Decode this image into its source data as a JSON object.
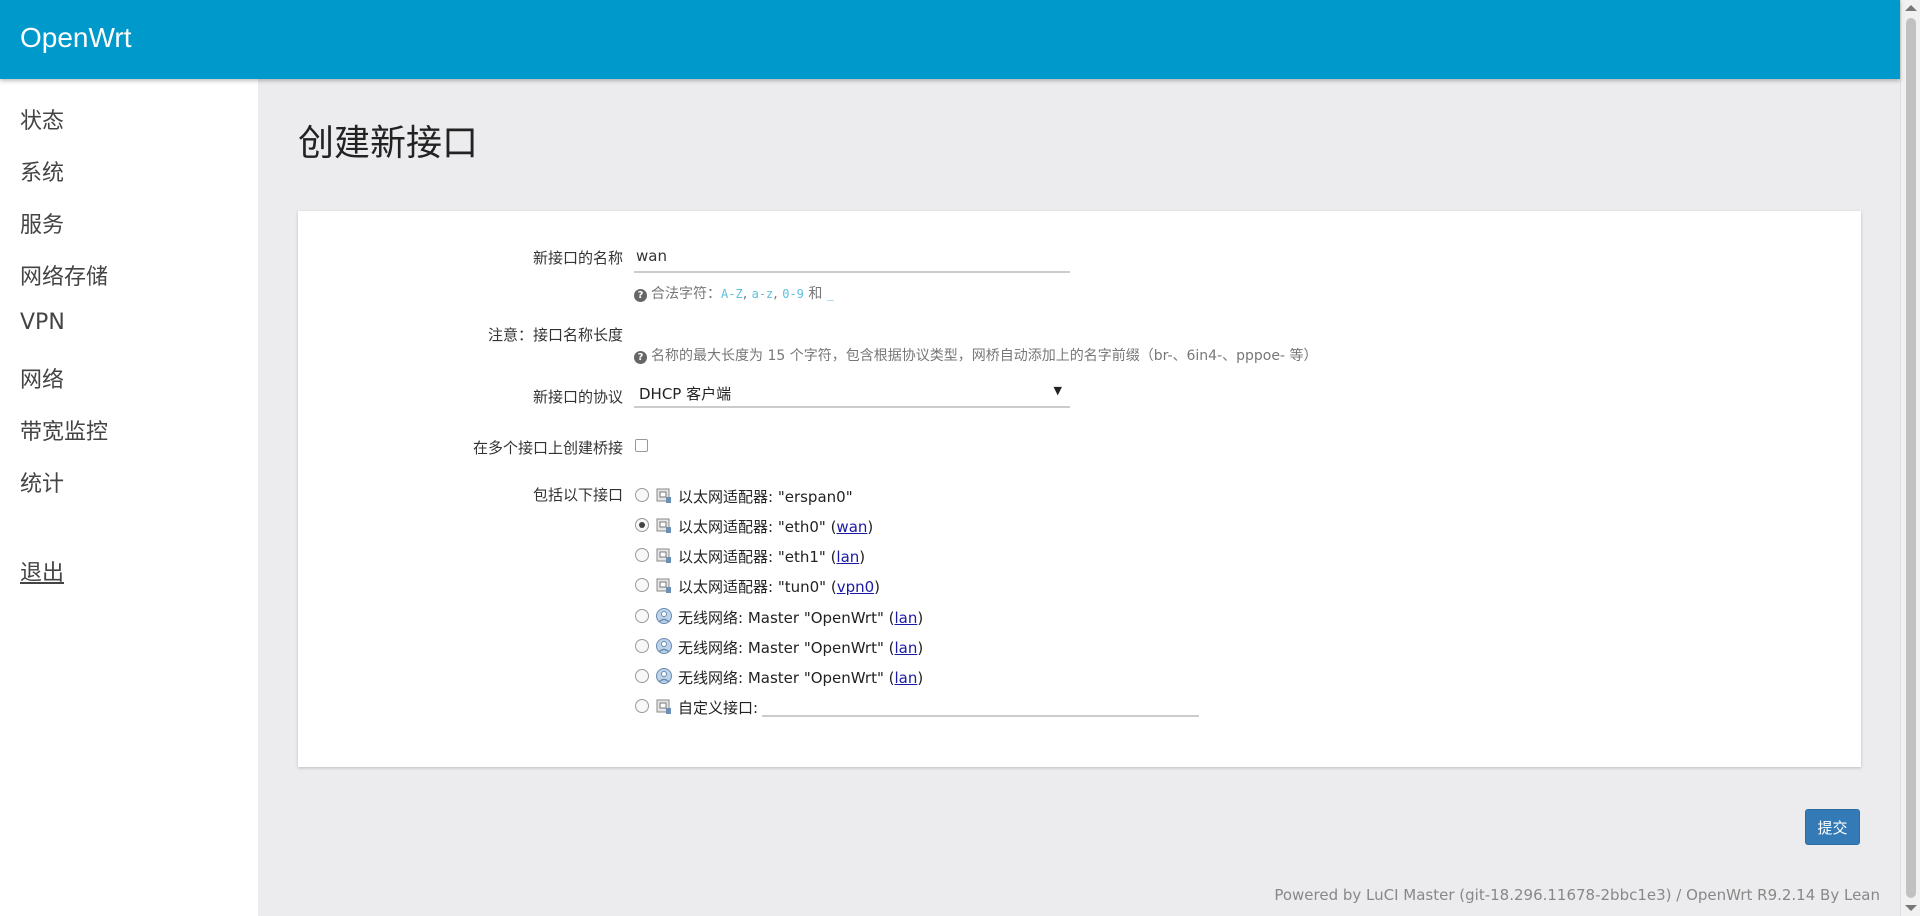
{
  "header": {
    "brand": "OpenWrt"
  },
  "sidebar": {
    "items": [
      {
        "label": "状态"
      },
      {
        "label": "系统"
      },
      {
        "label": "服务"
      },
      {
        "label": "网络存储"
      },
      {
        "label": "VPN"
      },
      {
        "label": "网络"
      },
      {
        "label": "带宽监控"
      },
      {
        "label": "统计"
      }
    ],
    "logout": "退出"
  },
  "page": {
    "title": "创建新接口"
  },
  "form": {
    "name_label": "新接口的名称",
    "name_value": "wan",
    "name_hint_prefix": "合法字符：",
    "name_hint_az": "A-Z",
    "name_hint_lower": "a-z",
    "name_hint_num": "0-9",
    "name_hint_and": " 和 ",
    "name_hint_underscore": "_",
    "note_label": "注意：接口名称长度",
    "note_hint": "名称的最大长度为 15 个字符，包含根据协议类型，网桥自动添加上的名字前缀（br-、6in4-、pppoe- 等）",
    "protocol_label": "新接口的协议",
    "protocol_value": "DHCP 客户端",
    "bridge_label": "在多个接口上创建桥接",
    "include_label": "包括以下接口",
    "interfaces": [
      {
        "text": "以太网适配器: \"erspan0\"",
        "network": "",
        "icon": "ethernet-icon",
        "checked": false
      },
      {
        "text": "以太网适配器: \"eth0\"",
        "network": "wan",
        "icon": "ethernet-icon",
        "checked": true
      },
      {
        "text": "以太网适配器: \"eth1\"",
        "network": "lan",
        "icon": "ethernet-icon",
        "checked": false
      },
      {
        "text": "以太网适配器: \"tun0\"",
        "network": "vpn0",
        "icon": "ethernet-icon",
        "checked": false
      },
      {
        "text": "无线网络: Master \"OpenWrt\"",
        "network": "lan",
        "icon": "wifi-icon",
        "checked": false
      },
      {
        "text": "无线网络: Master \"OpenWrt\"",
        "network": "lan",
        "icon": "wifi-icon",
        "checked": false
      },
      {
        "text": "无线网络: Master \"OpenWrt\"",
        "network": "lan",
        "icon": "wifi-icon",
        "checked": false
      },
      {
        "text": "自定义接口:",
        "network": "",
        "icon": "ethernet-icon",
        "checked": false
      }
    ]
  },
  "actions": {
    "submit": "提交"
  },
  "footer": {
    "text": "Powered by LuCI Master (git-18.296.11678-2bbc1e3) / OpenWrt R9.2.14 By Lean"
  },
  "colors": {
    "header": "#0099cc",
    "button": "#337ab7",
    "link": "#1a1aa6"
  }
}
